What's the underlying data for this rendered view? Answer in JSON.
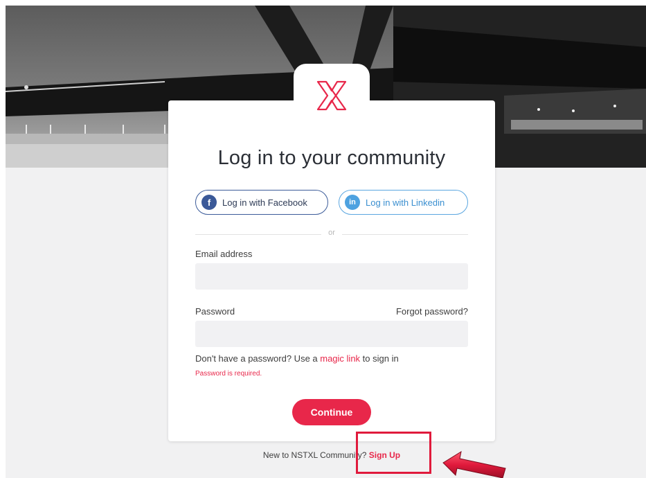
{
  "brand": {
    "logo_icon": "x-logo-icon",
    "accent": "#e8274a"
  },
  "login": {
    "title": "Log in to your community",
    "facebook_label": "Log in with Facebook",
    "facebook_icon_glyph": "f",
    "linkedin_label": "Log in with Linkedin",
    "linkedin_icon_glyph": "in",
    "divider_text": "or",
    "email_label": "Email address",
    "email_value": "",
    "password_label": "Password",
    "password_value": "",
    "forgot_password": "Forgot password?",
    "magic_prefix": "Don't have a password? Use a ",
    "magic_link": "magic link",
    "magic_suffix": " to sign in",
    "error_text": "Password is required.",
    "continue_label": "Continue"
  },
  "footer": {
    "new_prefix": "New to NSTXL Community? ",
    "signup_label": "Sign Up"
  },
  "annotation": {
    "highlight_color": "#e01a3c"
  }
}
